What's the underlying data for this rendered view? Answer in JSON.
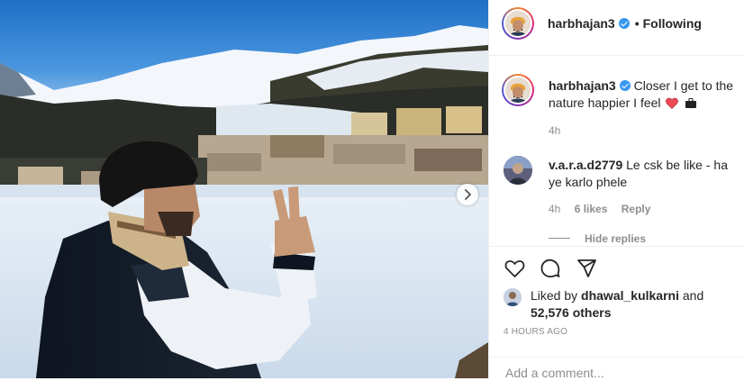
{
  "post": {
    "username": "harbhajan3",
    "follow_status": "Following",
    "caption_text": "Closer I get to the nature happier I feel",
    "caption_age": "4h",
    "timestamp": "4 HOURS AGO"
  },
  "comment": {
    "username": "v.a.r.a.d2779",
    "text": "Le csk be like - ha ye karlo phele",
    "age": "4h",
    "likes": "6 likes",
    "reply_label": "Reply",
    "hide_replies_label": "Hide replies"
  },
  "likes": {
    "prefix": "Liked by",
    "user": "dhawal_kulkarni",
    "conjunction": "and",
    "others": "52,576 others"
  },
  "add_comment": {
    "placeholder": "Add a comment..."
  },
  "icons": {
    "heart": "heart-outline-icon",
    "comment": "comment-bubble-icon",
    "share": "paper-plane-icon",
    "verified": "verified-badge-icon",
    "next": "chevron-right-icon",
    "caption_heart": "red-heart-emoji",
    "caption_bag": "briefcase-emoji"
  },
  "colors": {
    "verified": "#3897f0",
    "red_heart": "#ed4956",
    "muted": "#8e8e8e",
    "text": "#262626"
  }
}
